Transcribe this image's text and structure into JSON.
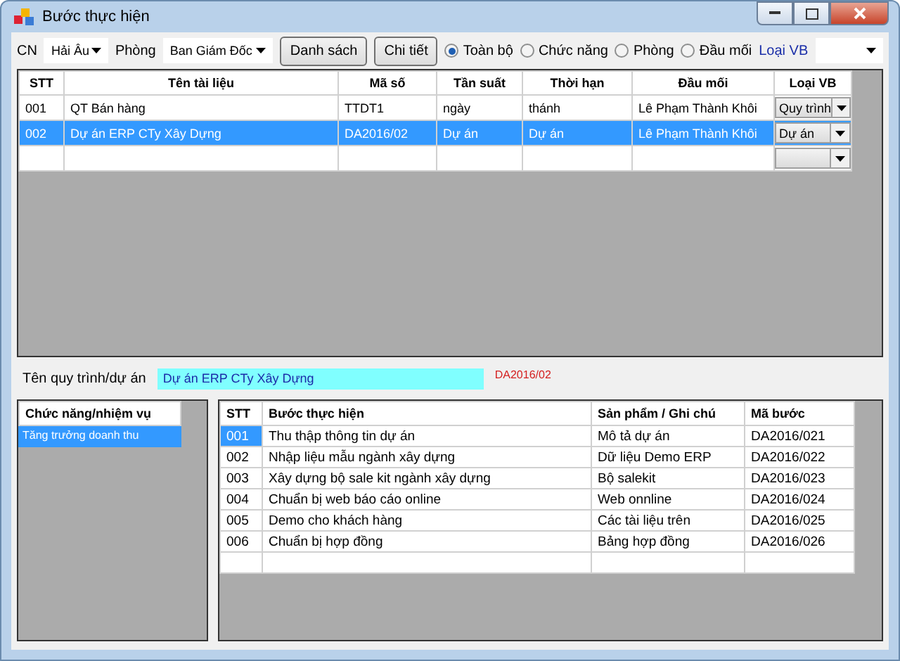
{
  "window": {
    "title": "Bước thực hiện"
  },
  "toolbar": {
    "branch": {
      "label": "CN",
      "value": "Hải Âu"
    },
    "department": {
      "label": "Phòng",
      "value": "Ban Giám Đốc"
    },
    "buttons": [
      "Danh sách",
      "Chi tiết"
    ],
    "filters": [
      {
        "label": "Toàn bộ",
        "selected": true
      },
      {
        "label": "Chức năng",
        "selected": false
      },
      {
        "label": "Phòng",
        "selected": false
      },
      {
        "label": "Đầu mối",
        "selected": false
      }
    ],
    "doc_type": {
      "label": "Loại VB"
    }
  },
  "documents": {
    "columns": [
      "STT",
      "Tên tài liệu",
      "Mã số",
      "Tần suất",
      "Thời hạn",
      "Đầu mối",
      "Loại VB"
    ],
    "rows": [
      {
        "cells": [
          "001",
          "QT Bán hàng",
          "TTDT1",
          "ngày",
          "thánh",
          "Lê Phạm Thành Khôi"
        ],
        "doc_type": "Quy trình",
        "selected": false
      },
      {
        "cells": [
          "002",
          "Dự án ERP CTy Xây Dựng",
          "DA2016/02",
          "Dự án",
          "Dự án",
          "Lê Phạm Thành Khôi"
        ],
        "doc_type": "Dự án",
        "selected": true
      }
    ]
  },
  "project": {
    "label": "Tên quy trình/dự án",
    "value": "Dự án ERP CTy Xây Dựng",
    "code": "DA2016/02"
  },
  "functions": {
    "header": "Chức năng/nhiệm vụ",
    "items": [
      {
        "label": "Tăng trưởng doanh thu",
        "selected": true
      }
    ]
  },
  "steps": {
    "columns": [
      "STT",
      "Bước thực hiện",
      "Sản phẩm / Ghi chú",
      "Mã bước"
    ],
    "rows": [
      {
        "cells": [
          "001",
          "Thu thập thông tin dự án",
          "Mô tả dự án",
          "DA2016/021"
        ],
        "selected": true
      },
      {
        "cells": [
          "002",
          "Nhập liệu mẫu ngành xây dựng",
          "Dữ liệu Demo ERP",
          "DA2016/022"
        ],
        "selected": false
      },
      {
        "cells": [
          "003",
          "Xây dựng bộ sale kit ngành xây dựng",
          "Bộ salekit",
          "DA2016/023"
        ],
        "selected": false
      },
      {
        "cells": [
          "004",
          "Chuẩn bị web báo cáo online",
          "Web onnline",
          "DA2016/024"
        ],
        "selected": false
      },
      {
        "cells": [
          "005",
          "Demo cho khách hàng",
          "Các tài liệu trên",
          "DA2016/025"
        ],
        "selected": false
      },
      {
        "cells": [
          "006",
          "Chuẩn bị hợp đồng",
          "Bảng hợp đồng",
          "DA2016/026"
        ],
        "selected": false
      }
    ]
  }
}
